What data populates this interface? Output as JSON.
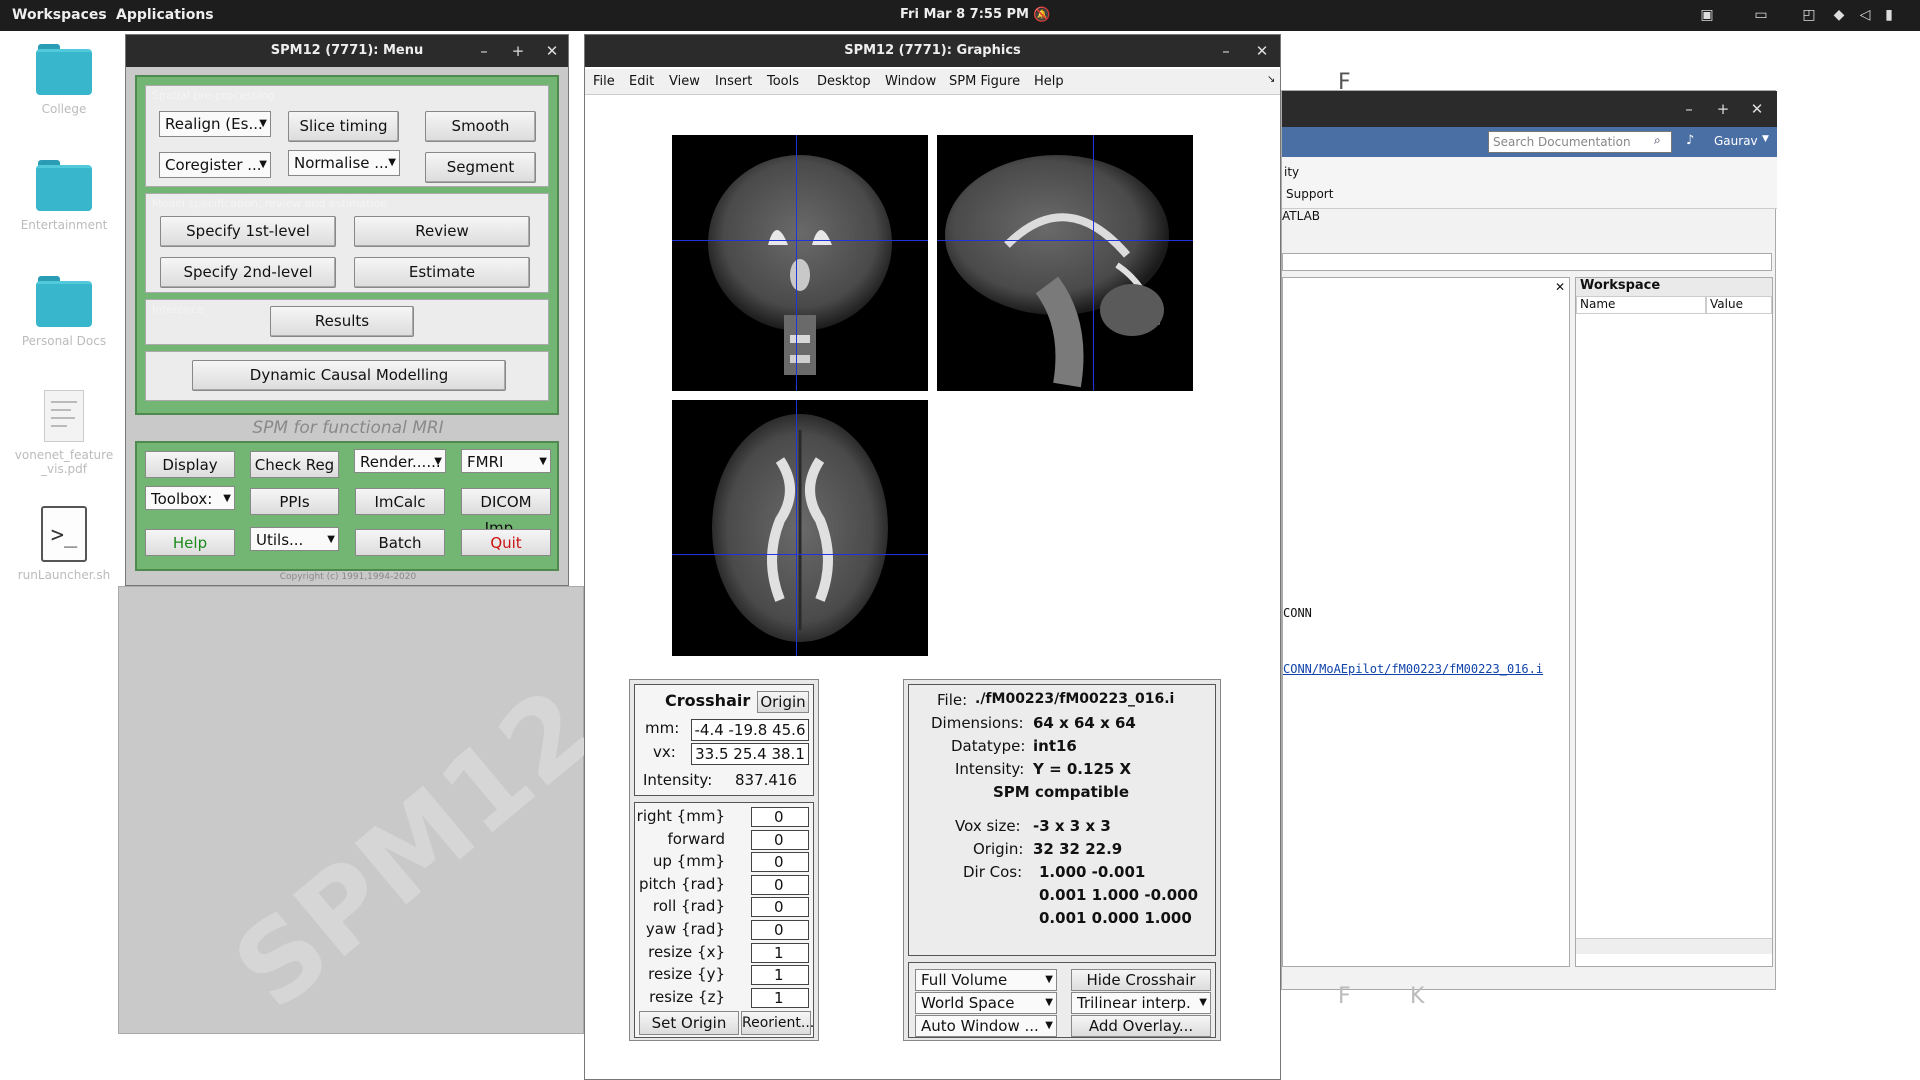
{
  "topbar": {
    "workspaces": "Workspaces",
    "applications": "Applications",
    "clock": "Fri Mar 8   7:55 PM"
  },
  "desktop": {
    "icons": [
      {
        "label": "College"
      },
      {
        "label": "Entertainment"
      },
      {
        "label": "Personal Docs"
      },
      {
        "label": "vonenet_feature_vis.pdf"
      },
      {
        "label": "runLauncher.sh"
      }
    ]
  },
  "spm_menu": {
    "title": "SPM12 (7771): Menu",
    "section_spatial": "Spatial pre-processing",
    "realign": "Realign (Es...",
    "slice_timing": "Slice timing",
    "smooth": "Smooth",
    "coregister": "Coregister ...",
    "normalise": "Normalise ...",
    "segment": "Segment",
    "section_model": "Model specification, review and estimation",
    "specify_1st": "Specify 1st-level",
    "review": "Review",
    "specify_2nd": "Specify 2nd-level",
    "estimate": "Estimate",
    "section_inference": "Inference",
    "results": "Results",
    "dcm": "Dynamic Causal Modelling",
    "subtitle": "SPM for functional MRI",
    "display": "Display",
    "check_reg": "Check Reg",
    "render": "Render......",
    "modality": "FMRI",
    "toolbox": "Toolbox:",
    "ppis": "PPIs",
    "imcalc": "ImCalc",
    "dicom": "DICOM Imp...",
    "help": "Help",
    "utils": "Utils...",
    "batch": "Batch",
    "quit": "Quit",
    "copyright": "Copyright (c) 1991,1994-2020"
  },
  "spm_graphics": {
    "title": "SPM12 (7771): Graphics",
    "menu": [
      "File",
      "Edit",
      "View",
      "Insert",
      "Tools",
      "Desktop",
      "Window",
      "SPM Figure",
      "Help"
    ],
    "crosshair": {
      "title": "Crosshair",
      "origin_btn": "Origin",
      "mm_label": "mm:",
      "mm_value": "-4.4 -19.8 45.6",
      "vx_label": "vx:",
      "vx_value": "33.5 25.4 38.1",
      "intensity_label": "Intensity:",
      "intensity_value": "837.416"
    },
    "reorient": {
      "rows": [
        {
          "label": "right  {mm}",
          "value": "0"
        },
        {
          "label": "forward",
          "value": "0"
        },
        {
          "label": "up  {mm}",
          "value": "0"
        },
        {
          "label": "pitch  {rad}",
          "value": "0"
        },
        {
          "label": "roll  {rad}",
          "value": "0"
        },
        {
          "label": "yaw  {rad}",
          "value": "0"
        },
        {
          "label": "resize  {x}",
          "value": "1"
        },
        {
          "label": "resize  {y}",
          "value": "1"
        },
        {
          "label": "resize  {z}",
          "value": "1"
        }
      ],
      "set_origin": "Set Origin",
      "reorient": "Reorient..."
    },
    "fileinfo": {
      "file_label": "File:",
      "file_value": "./fM00223/fM00223_016.i",
      "dims_label": "Dimensions:",
      "dims_value": "64 x 64 x 64",
      "datatype_label": "Datatype:",
      "datatype_value": "int16",
      "intensity_label": "Intensity:",
      "intensity_value": "Y  = 0.125 X",
      "spm_compat": "SPM compatible",
      "voxsize_label": "Vox size:",
      "voxsize_value": "-3 x 3 x 3",
      "origin_label": "Origin:",
      "origin_value": "32 32 22.9",
      "dircos_label": "Dir Cos:",
      "dircos_row1": "1.000 -0.001",
      "dircos_row2": "0.001   1.000 -0.000",
      "dircos_row3": "0.001   0.000   1.000"
    },
    "controls": {
      "full_volume": "Full Volume",
      "hide_crosshair": "Hide Crosshair",
      "world_space": "World Space",
      "trilinear": "Trilinear interp.",
      "auto_window": "Auto Window ...",
      "add_overlay": "Add Overlay..."
    }
  },
  "matlab": {
    "search_placeholder": "Search Documentation",
    "user": "Gaurav",
    "side_items": [
      "ity",
      "Support",
      "ATLAB"
    ],
    "workspace_title": "Workspace",
    "col_name": "Name",
    "col_value": "Value",
    "cmd_text_1": "CONN",
    "cmd_link": "CONN/MoAEpilot/fM00223/fM00223_016.i"
  },
  "background_letters": [
    "F",
    "F",
    "K"
  ]
}
